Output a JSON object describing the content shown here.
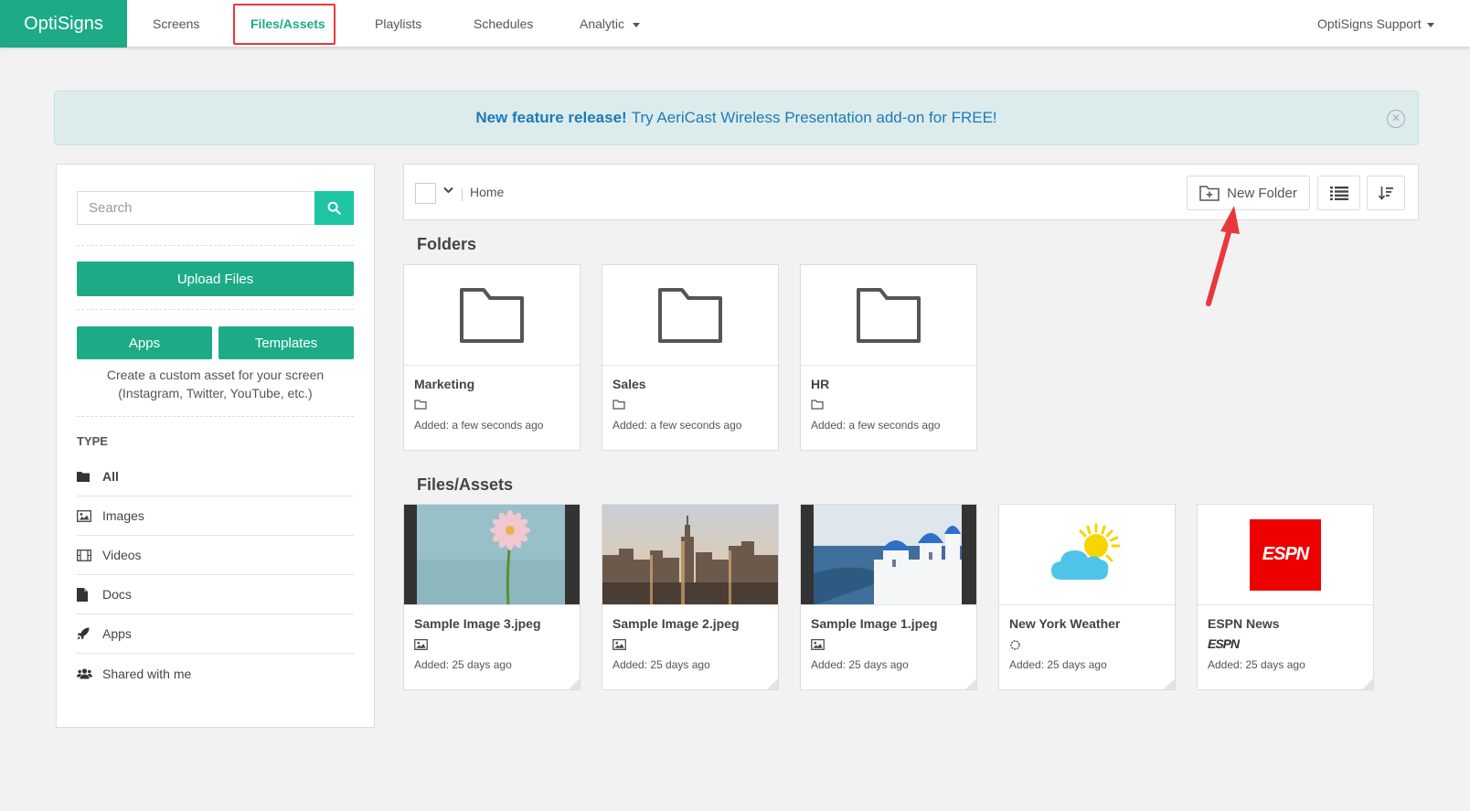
{
  "nav": {
    "brand": "OptiSigns",
    "items": [
      "Screens",
      "Files/Assets",
      "Playlists",
      "Schedules",
      "Analytic"
    ],
    "user": "OptiSigns Support"
  },
  "banner": {
    "bold": "New feature release!",
    "text": "Try AeriCast Wireless Presentation add-on for FREE!"
  },
  "sidebar": {
    "search_placeholder": "Search",
    "upload_label": "Upload Files",
    "apps_label": "Apps",
    "templates_label": "Templates",
    "note_line1": "Create a custom asset for your screen",
    "note_line2": "(Instagram, Twitter, YouTube, etc.)",
    "type_label": "TYPE",
    "types": [
      "All",
      "Images",
      "Videos",
      "Docs",
      "Apps",
      "Shared with me"
    ]
  },
  "toolbar": {
    "breadcrumb": "Home",
    "new_folder_label": "New Folder"
  },
  "folders_title": "Folders",
  "folders": [
    {
      "name": "Marketing",
      "added": "Added: a few seconds ago"
    },
    {
      "name": "Sales",
      "added": "Added: a few seconds ago"
    },
    {
      "name": "HR",
      "added": "Added: a few seconds ago"
    }
  ],
  "files_title": "Files/Assets",
  "files": [
    {
      "name": "Sample Image 3.jpeg",
      "added": "Added: 25 days ago"
    },
    {
      "name": "Sample Image 2.jpeg",
      "added": "Added: 25 days ago"
    },
    {
      "name": "Sample Image 1.jpeg",
      "added": "Added: 25 days ago"
    },
    {
      "name": "New York Weather",
      "added": "Added: 25 days ago"
    },
    {
      "name": "ESPN News",
      "added": "Added: 25 days ago",
      "logo": "ESPN"
    }
  ],
  "colors": {
    "brand": "#1dab87",
    "accent": "#1dc5a3",
    "highlight": "#e8383d",
    "link": "#1e7ab8"
  }
}
